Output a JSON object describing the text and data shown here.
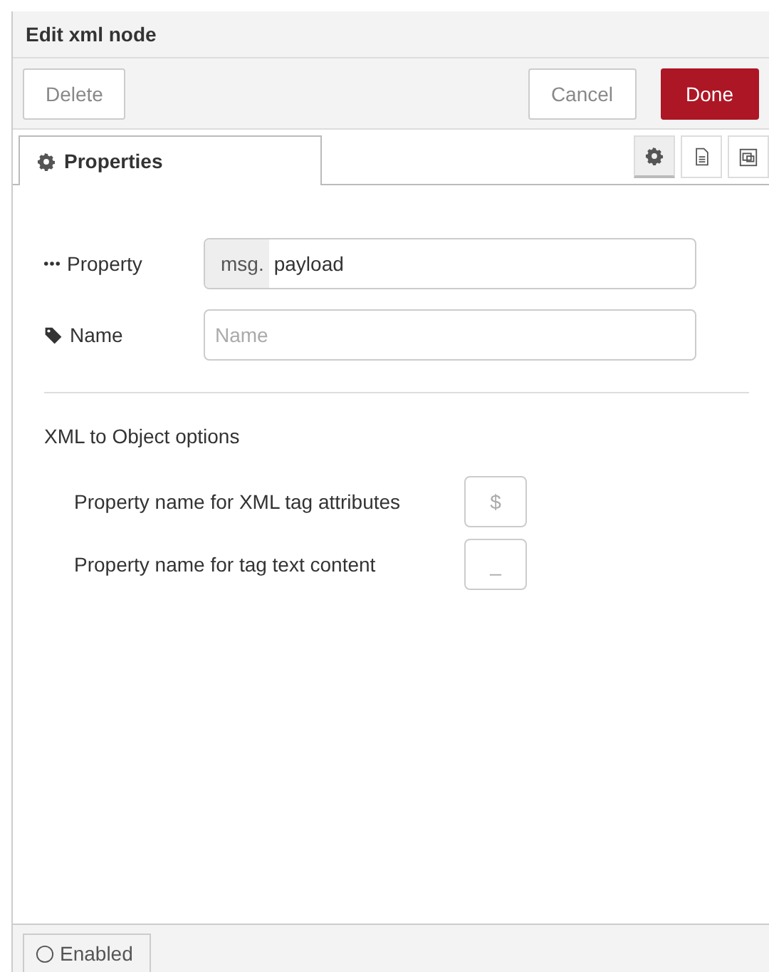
{
  "window": {
    "title": "Edit xml node"
  },
  "toolbar": {
    "delete": "Delete",
    "cancel": "Cancel",
    "done": "Done"
  },
  "tabs": [
    {
      "label": "Properties",
      "selected": true
    }
  ],
  "icon_tabs": [
    {
      "kind": "gear",
      "selected": true
    },
    {
      "kind": "document",
      "selected": false
    },
    {
      "kind": "frame",
      "selected": false
    }
  ],
  "fields": [
    {
      "kind": "typed",
      "label": "Property",
      "prefix": "msg.",
      "value": "payload"
    },
    {
      "kind": "text",
      "label": "Name",
      "placeholder": "Name"
    }
  ],
  "section_title": "XML to Object options",
  "options": [
    {
      "label": "Property name for XML tag attributes",
      "placeholder": "$"
    },
    {
      "label": "Property name for tag text content",
      "placeholder": "_"
    }
  ],
  "footer": {
    "label": "Enabled",
    "enabled": false
  }
}
